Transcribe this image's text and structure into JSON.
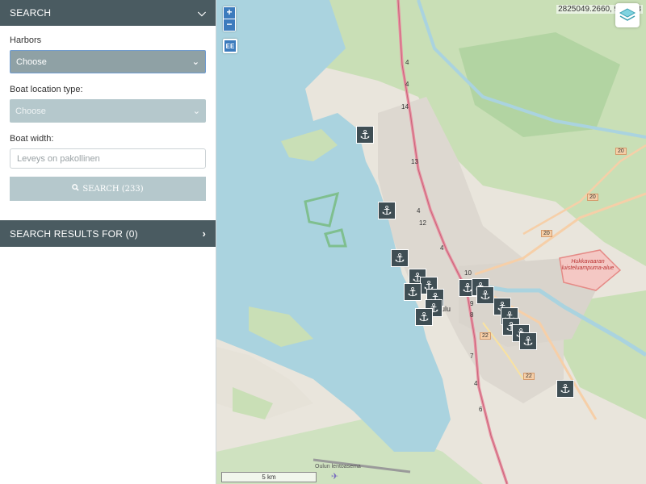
{
  "search_panel": {
    "title": "SEARCH",
    "collapse_icon": "chevron-down-icon"
  },
  "harbors": {
    "label": "Harbors",
    "value": "Choose"
  },
  "boat_location_type": {
    "label": "Boat location type:",
    "value": "Choose"
  },
  "boat_width": {
    "label": "Boat width:",
    "placeholder": "Leveys on pakollinen",
    "value": ""
  },
  "search_button": {
    "label": "SEARCH (233)",
    "icon": "search-icon"
  },
  "results_panel": {
    "title": "SEARCH RESULTS FOR (0)",
    "expand_icon": "chevron-right-icon"
  },
  "map": {
    "zoom_in": "+",
    "zoom_out": "−",
    "extent_button": "EE",
    "coordinates": "2825049.2660, 962403",
    "layers_icon": "layers-icon",
    "scale": "5 km",
    "area_label": "Hukkavaaran\nluisteluampuma-alue",
    "city_label": "ulu",
    "airport_label": "Oulun lentoasema",
    "road_numbers": [
      "4",
      "4",
      "14",
      "13",
      "4",
      "12",
      "4",
      "10",
      "9",
      "8",
      "7",
      "4",
      "6",
      "20",
      "20",
      "20",
      "22",
      "22"
    ],
    "marker_icon": "anchor-icon",
    "marker_symbol": "⚓",
    "marker_count": 18
  },
  "colors": {
    "header_bg": "#4a5b61",
    "select_active": "#8fa1a5",
    "select_disabled": "#b5c8cc",
    "water": "#aad3df",
    "forest": "#add19e",
    "marker_bg": "#3f4e54",
    "zoom_blue": "#3c7bbd"
  }
}
